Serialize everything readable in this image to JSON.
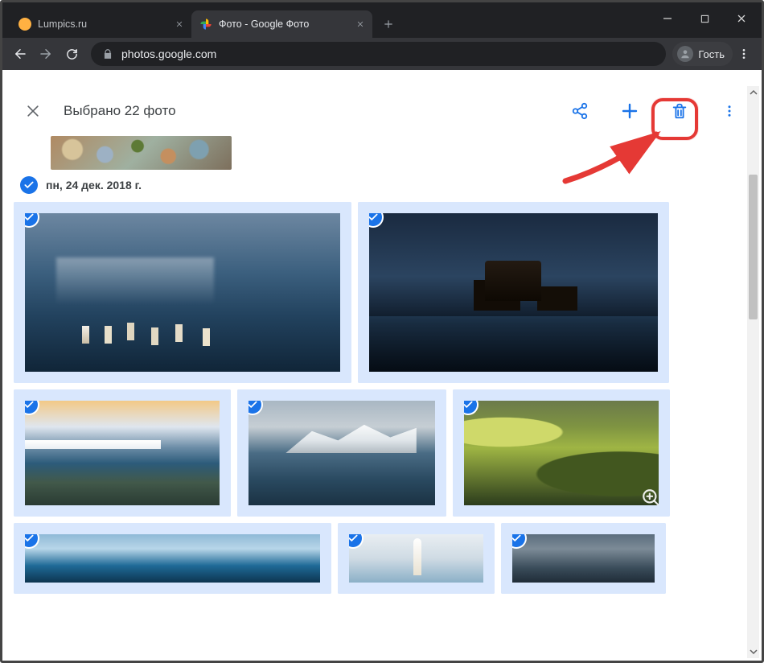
{
  "chrome": {
    "tabs": [
      {
        "title": "Lumpics.ru",
        "favicon": "orange"
      },
      {
        "title": "Фото - Google Фото",
        "favicon": "google-photos"
      }
    ],
    "address_bar": {
      "secure": true,
      "host": "photos.google.com",
      "path": ""
    },
    "profile_label": "Гость",
    "window_controls": {
      "minimize": "—",
      "maximize": "□",
      "close": "×"
    }
  },
  "selection_bar": {
    "close_tooltip": "Закрыть",
    "count_text": "Выбрано 22 фото",
    "actions": {
      "share": "share",
      "add": "add",
      "delete": "delete",
      "more": "more"
    }
  },
  "date_group": {
    "label": "пн, 24 дек. 2018 г."
  },
  "photos": {
    "row1": [
      {
        "id": "boats-mist",
        "selected": true
      },
      {
        "id": "castle-dusk",
        "selected": true
      }
    ],
    "row2": [
      {
        "id": "coast-sunrise",
        "selected": true
      },
      {
        "id": "lake-mountains",
        "selected": true
      },
      {
        "id": "green-hills",
        "selected": true
      }
    ],
    "row3": [
      {
        "id": "blue-sea",
        "selected": true
      },
      {
        "id": "lighthouse",
        "selected": true
      },
      {
        "id": "storm-clouds",
        "selected": true
      }
    ]
  }
}
